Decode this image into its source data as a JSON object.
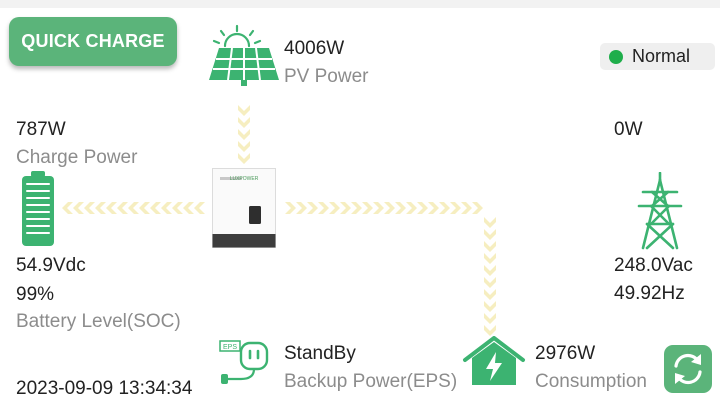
{
  "header": {
    "quick_charge_label": "QUICK CHARGE",
    "status_label": "Normal",
    "status_color": "#1fae4b"
  },
  "pv": {
    "power": "4006W",
    "label": "PV Power"
  },
  "battery": {
    "charge_power": "787W",
    "charge_label": "Charge Power",
    "voltage": "54.9Vdc",
    "soc": "99%",
    "soc_label": "Battery Level(SOC)"
  },
  "grid": {
    "power": "0W",
    "voltage": "248.0Vac",
    "frequency": "49.92Hz"
  },
  "eps": {
    "icon_text": "EPS",
    "status": "StandBy",
    "label": "Backup Power(EPS)"
  },
  "consumption": {
    "power": "2976W",
    "label": "Consumption"
  },
  "footer": {
    "timestamp": "2023-09-09 13:34:34"
  },
  "inverter": {
    "brand_text": "LUXPOWER"
  },
  "colors": {
    "accent": "#5bb47a",
    "icon_green": "#3cb371",
    "flow": "#f6eec0"
  },
  "icons": {
    "pv": "solar-panel-icon",
    "battery": "battery-icon",
    "grid": "power-tower-icon",
    "eps": "eps-plug-icon",
    "home": "home-icon",
    "refresh": "refresh-icon"
  }
}
